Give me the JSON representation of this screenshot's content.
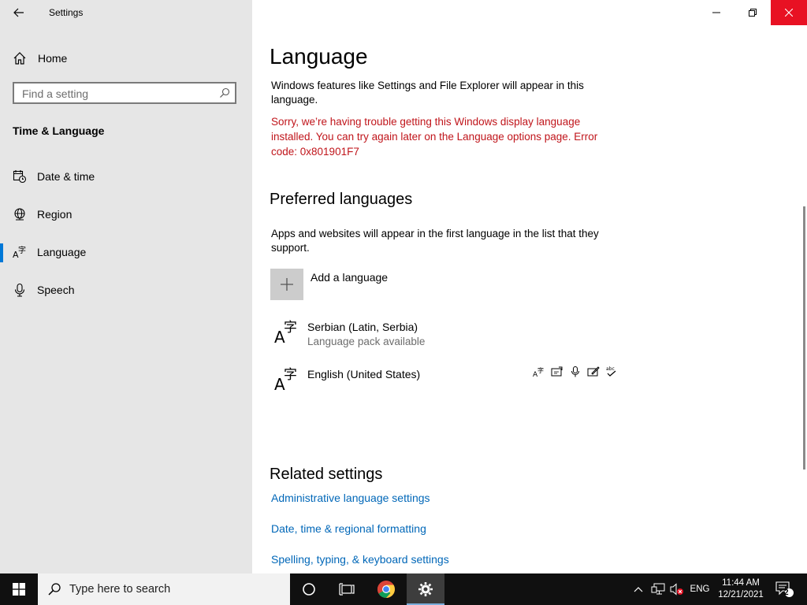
{
  "window": {
    "app_title": "Settings"
  },
  "sidebar": {
    "home_label": "Home",
    "search_placeholder": "Find a setting",
    "section_title": "Time & Language",
    "items": [
      {
        "label": "Date & time",
        "icon": "calendar-clock-icon",
        "active": false
      },
      {
        "label": "Region",
        "icon": "globe-icon",
        "active": false
      },
      {
        "label": "Language",
        "icon": "language-icon",
        "active": true
      },
      {
        "label": "Speech",
        "icon": "microphone-icon",
        "active": false
      }
    ]
  },
  "main": {
    "title": "Language",
    "description": "Windows features like Settings and File Explorer will appear in this language.",
    "error": "Sorry, we’re having trouble getting this Windows display language installed. You can try again later on the Language options page. Error code: 0x801901F7",
    "preferred": {
      "title": "Preferred languages",
      "description": "Apps and websites will appear in the first language in the list that they support.",
      "add_label": "Add a language",
      "languages": [
        {
          "name": "Serbian (Latin, Serbia)",
          "status": "Language pack available"
        },
        {
          "name": "English (United States)",
          "status": ""
        }
      ],
      "feature_icons": [
        "display-language-icon",
        "text-to-speech-icon",
        "speech-recognition-icon",
        "handwriting-icon",
        "spell-check-icon"
      ]
    },
    "related": {
      "title": "Related settings",
      "links": [
        "Administrative language settings",
        "Date, time & regional formatting",
        "Spelling, typing, & keyboard settings"
      ]
    }
  },
  "taskbar": {
    "search_text": "Type here to search",
    "language": "ENG",
    "time": "11:44 AM",
    "date": "12/21/2021",
    "notifications": "2"
  },
  "colors": {
    "accent": "#0078d7",
    "error": "#c0151b",
    "link": "#0067b8",
    "close_button": "#e81123"
  }
}
